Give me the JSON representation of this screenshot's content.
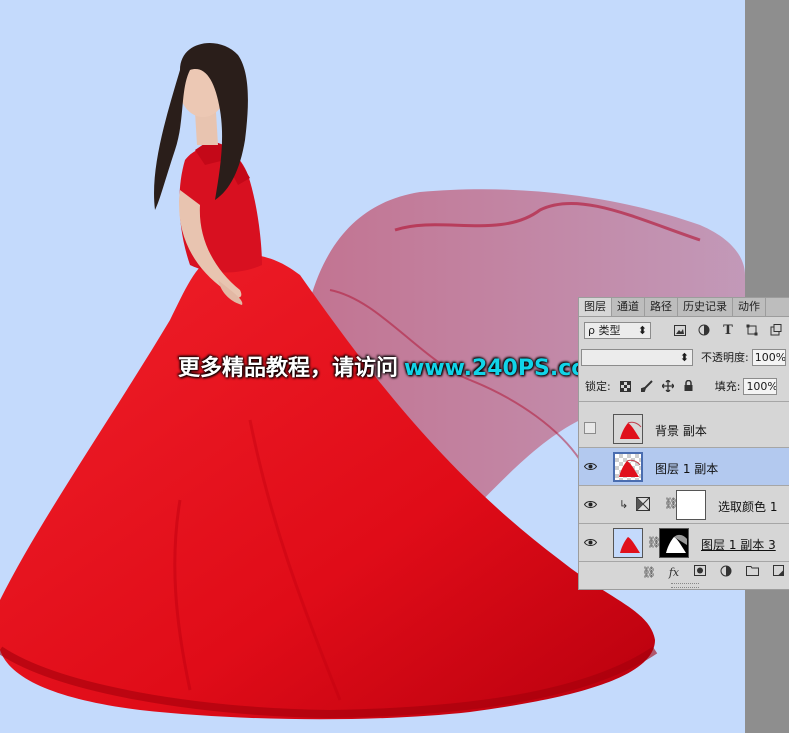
{
  "colors": {
    "canvas_bg": "#c4dafc",
    "dress": "#e8101c",
    "panel_bg": "#d6d6d6",
    "selected_layer": "#b3c9ef",
    "watermark_url": "#11d4e8"
  },
  "watermark": {
    "text": "更多精品教程，请访问",
    "url": "www.240PS.com"
  },
  "panel": {
    "tabs": [
      "图层",
      "通道",
      "路径",
      "历史记录",
      "动作"
    ],
    "filter": {
      "label": "ρ 类型",
      "arrow": "⬍",
      "icons": [
        "image-filter-icon",
        "adjustment-filter-icon",
        "type-filter-icon",
        "shape-filter-icon",
        "smart-object-filter-icon"
      ],
      "type_glyph": "T"
    },
    "blend": {
      "value": ""
    },
    "opacity": {
      "label": "不透明度:",
      "value": "100%"
    },
    "lock": {
      "label": "锁定:",
      "icons": [
        "lock-transparent-icon",
        "lock-image-icon",
        "lock-position-icon",
        "lock-all-icon"
      ]
    },
    "fill": {
      "label": "填充:",
      "value": "100%"
    },
    "layers": [
      {
        "name": "背景 副本",
        "visible": false,
        "selected": false
      },
      {
        "name": "图层 1 副本",
        "visible": true,
        "selected": true
      },
      {
        "name": "选取颜色 1",
        "visible": true,
        "selected": false
      },
      {
        "name": "图层 1 副本 3",
        "visible": true,
        "selected": false
      }
    ],
    "bottom_icons": [
      "link-layers-icon",
      "fx-icon",
      "add-mask-icon",
      "adjustment-layer-icon",
      "group-folder-icon",
      "new-layer-icon"
    ],
    "fx_label": "fx"
  }
}
